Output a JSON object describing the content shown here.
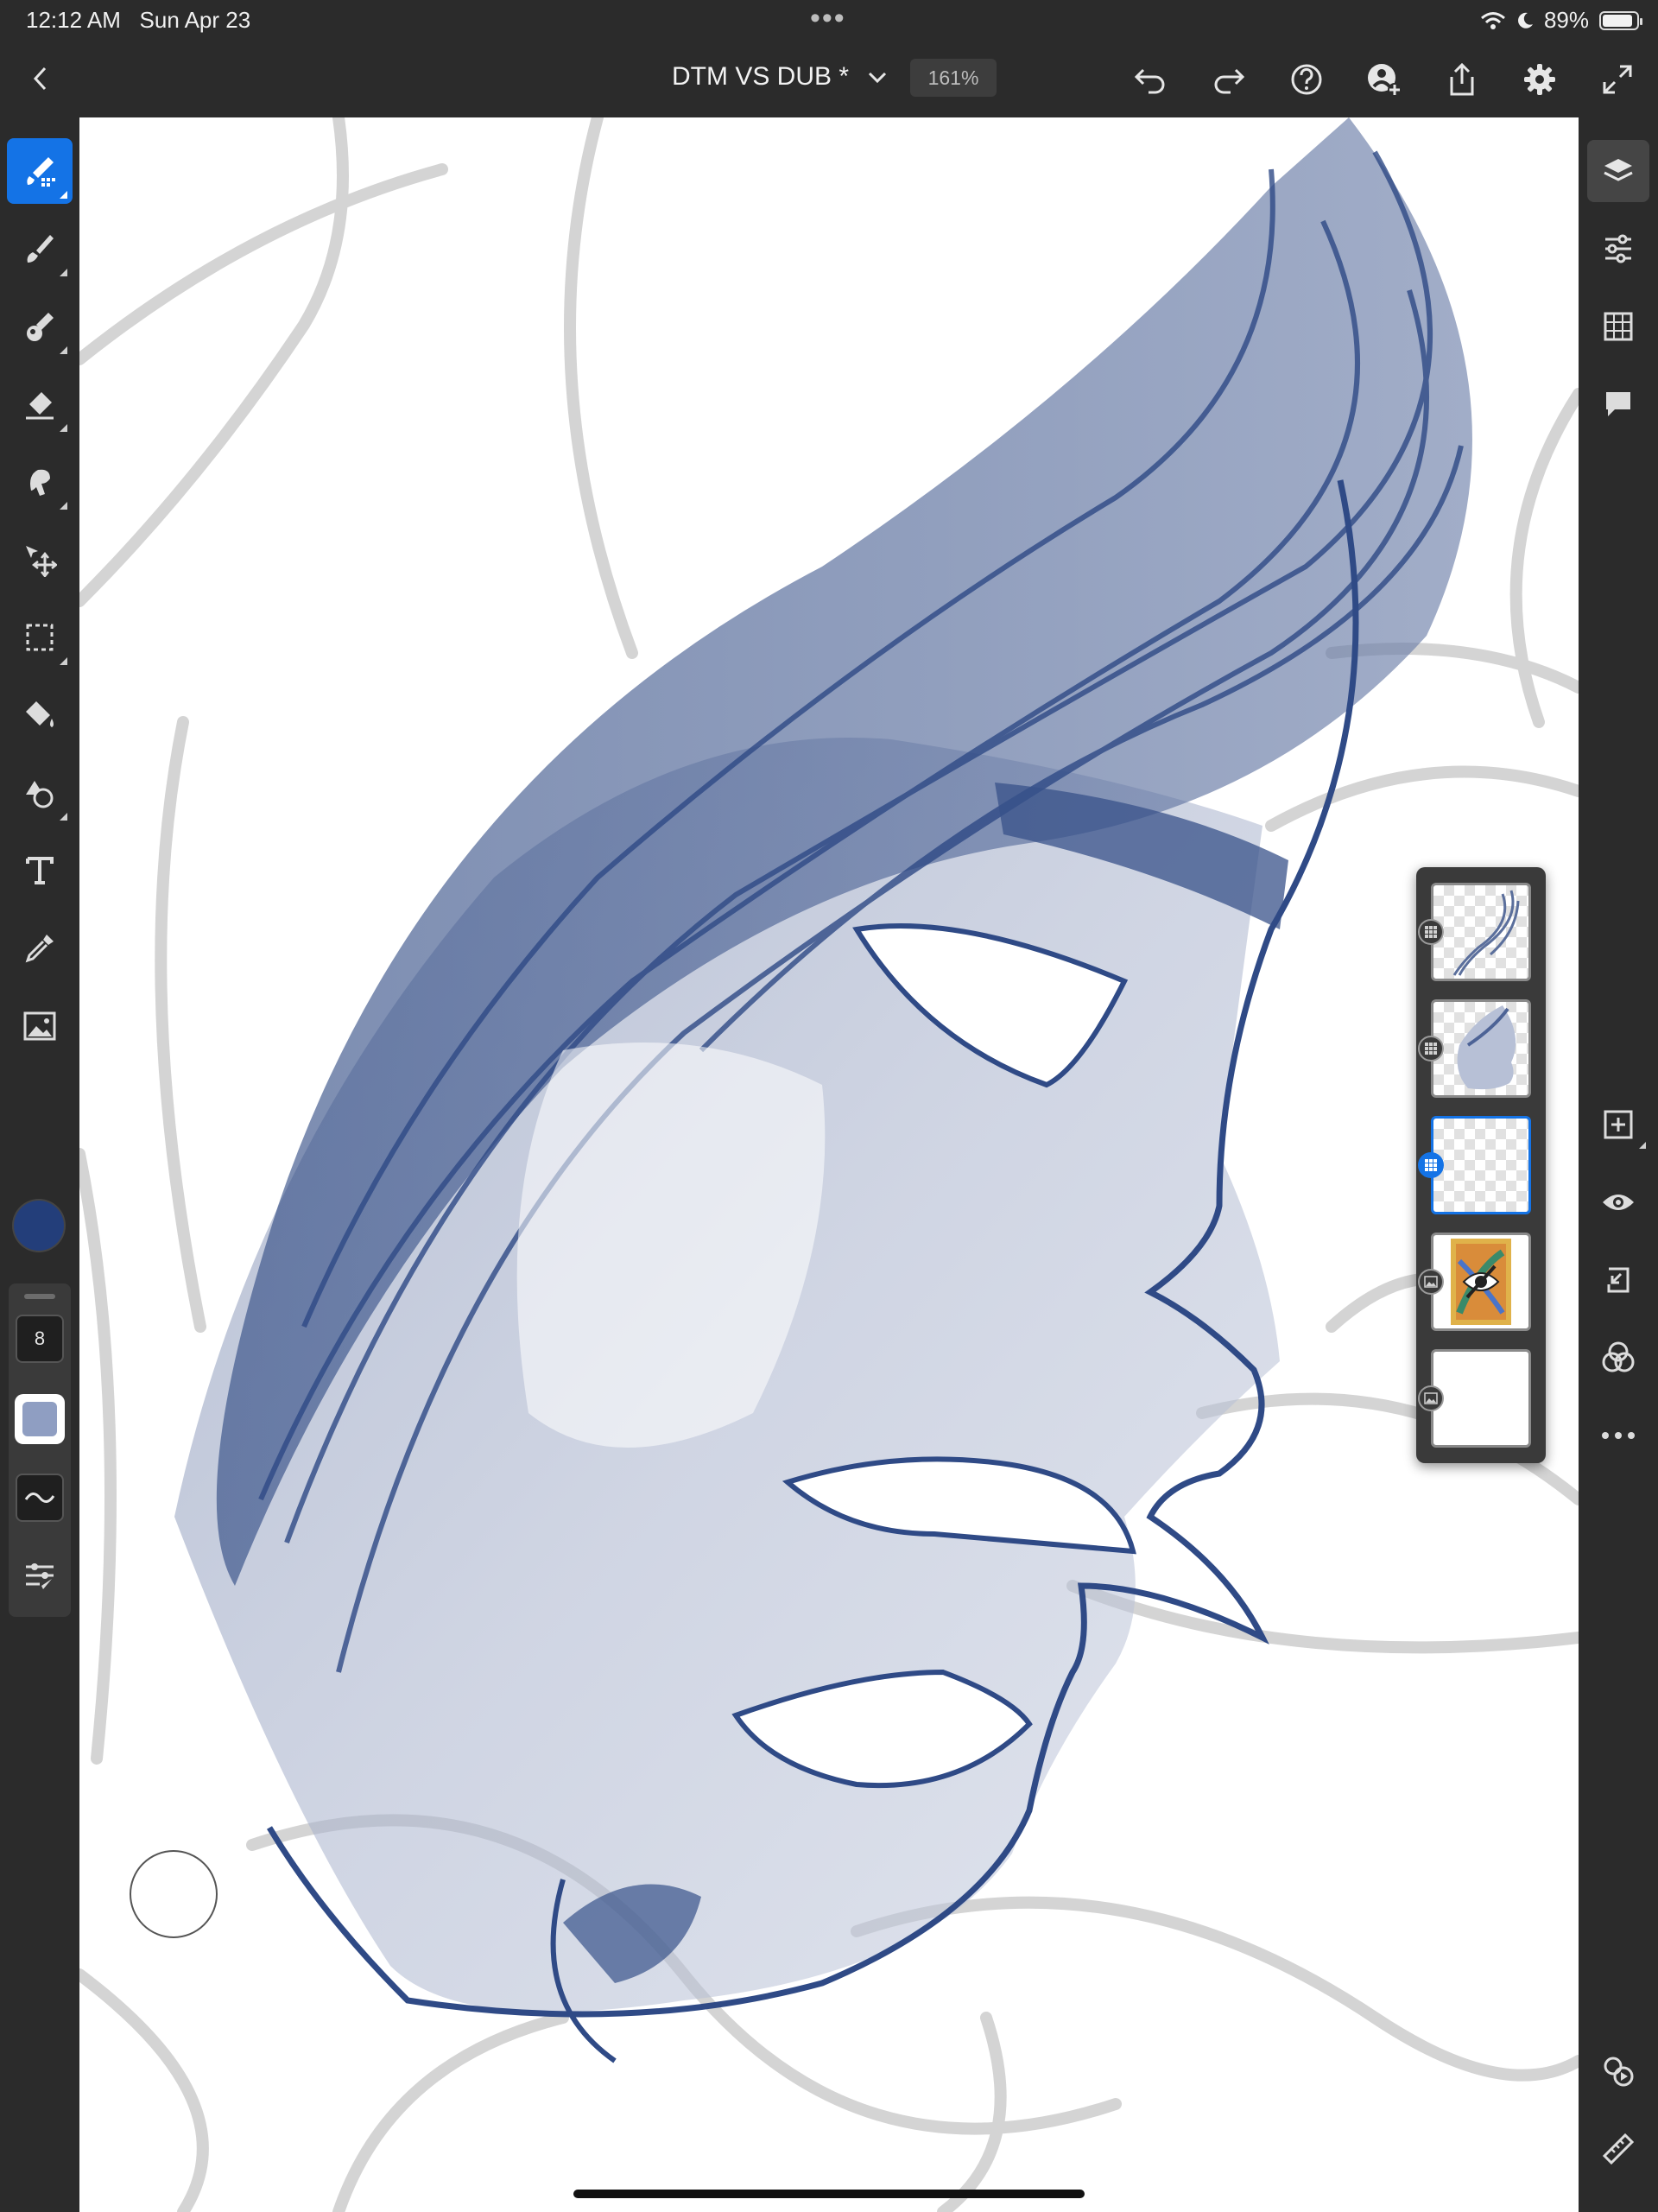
{
  "status_bar": {
    "time": "12:12 AM",
    "date": "Sun Apr 23",
    "dots": "•••",
    "battery_percent": "89%",
    "battery_level": 0.89
  },
  "toolbar": {
    "doc_title": "DTM VS DUB *",
    "zoom": "161%",
    "icons": [
      "chevron-left-icon",
      "chevron-down-icon",
      "undo-icon",
      "redo-icon",
      "help-icon",
      "invite-user-icon",
      "share-icon",
      "gear-icon",
      "fullscreen-icon"
    ]
  },
  "left_tools": [
    {
      "name": "pixel-brush-tool",
      "icon": "pixel-brush-icon",
      "active": true
    },
    {
      "name": "paint-brush-tool",
      "icon": "paint-brush-icon"
    },
    {
      "name": "mixer-brush-tool",
      "icon": "mixer-brush-icon"
    },
    {
      "name": "eraser-tool",
      "icon": "eraser-icon"
    },
    {
      "name": "smudge-tool",
      "icon": "smudge-icon"
    },
    {
      "name": "move-tool",
      "icon": "move-icon"
    },
    {
      "name": "selection-tool",
      "icon": "marquee-icon"
    },
    {
      "name": "fill-tool",
      "icon": "paint-bucket-icon"
    },
    {
      "name": "shapes-tool",
      "icon": "shapes-icon"
    },
    {
      "name": "text-tool",
      "icon": "text-icon"
    },
    {
      "name": "eyedropper-tool",
      "icon": "eyedropper-icon"
    },
    {
      "name": "place-image-tool",
      "icon": "image-icon"
    }
  ],
  "brush": {
    "color": "#233e7a",
    "size": "8",
    "opacity_color": "#8f9ec2"
  },
  "right_tools": [
    "layers-icon",
    "adjustments-icon",
    "grid-icon",
    "comment-icon",
    "add-layer-icon",
    "visibility-eye-icon",
    "import-icon",
    "blend-modes-icon",
    "more-dots-icon",
    "history-icon",
    "ruler-icon"
  ],
  "layers": [
    {
      "name": "hair-sketch-layer",
      "type": "pixel",
      "selected": false
    },
    {
      "name": "face-render-layer",
      "type": "pixel",
      "selected": false
    },
    {
      "name": "empty-pixel-layer",
      "type": "pixel",
      "selected": true
    },
    {
      "name": "reference-image-layer",
      "type": "image",
      "hidden": true
    },
    {
      "name": "background-layer",
      "type": "image",
      "selected": false
    }
  ]
}
